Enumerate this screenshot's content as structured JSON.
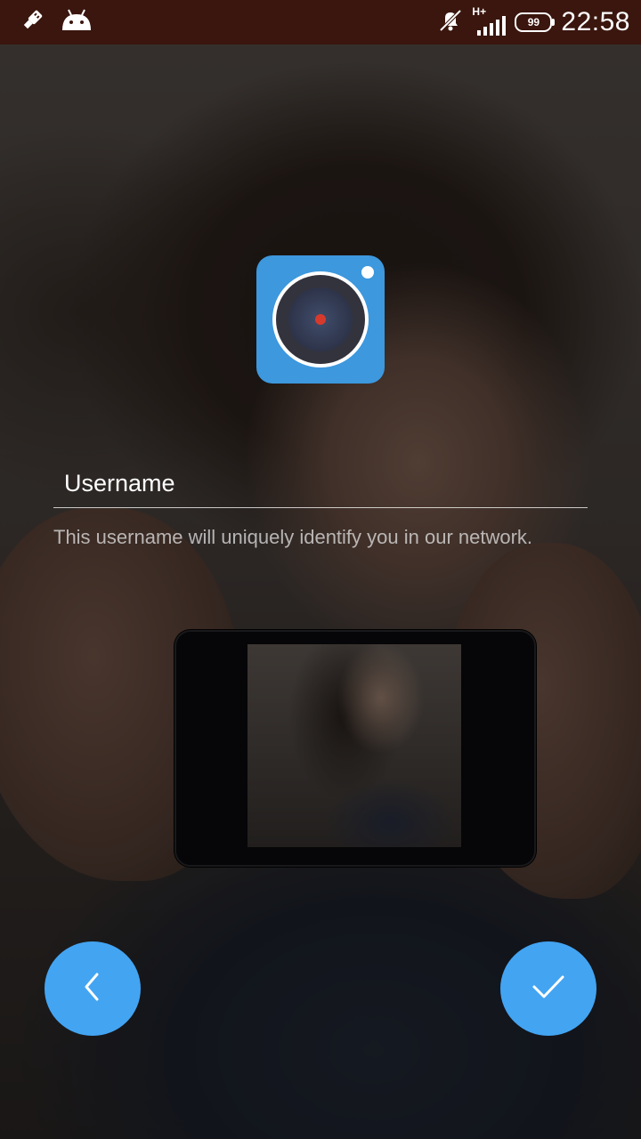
{
  "status_bar": {
    "time": "22:58",
    "battery": "99",
    "network": "H+",
    "icons": [
      "usb-icon",
      "android-icon",
      "mute-icon",
      "signal-icon",
      "battery-icon"
    ]
  },
  "app": {
    "icon": "camera-lens-icon",
    "accent": "#3d98dd"
  },
  "form": {
    "username_placeholder": "Username",
    "username_value": "",
    "helper_text": "This username will uniquely identify you in our network."
  },
  "actions": {
    "back_icon": "chevron-left-icon",
    "confirm_icon": "checkmark-icon",
    "fab_color": "#43a4f2"
  }
}
